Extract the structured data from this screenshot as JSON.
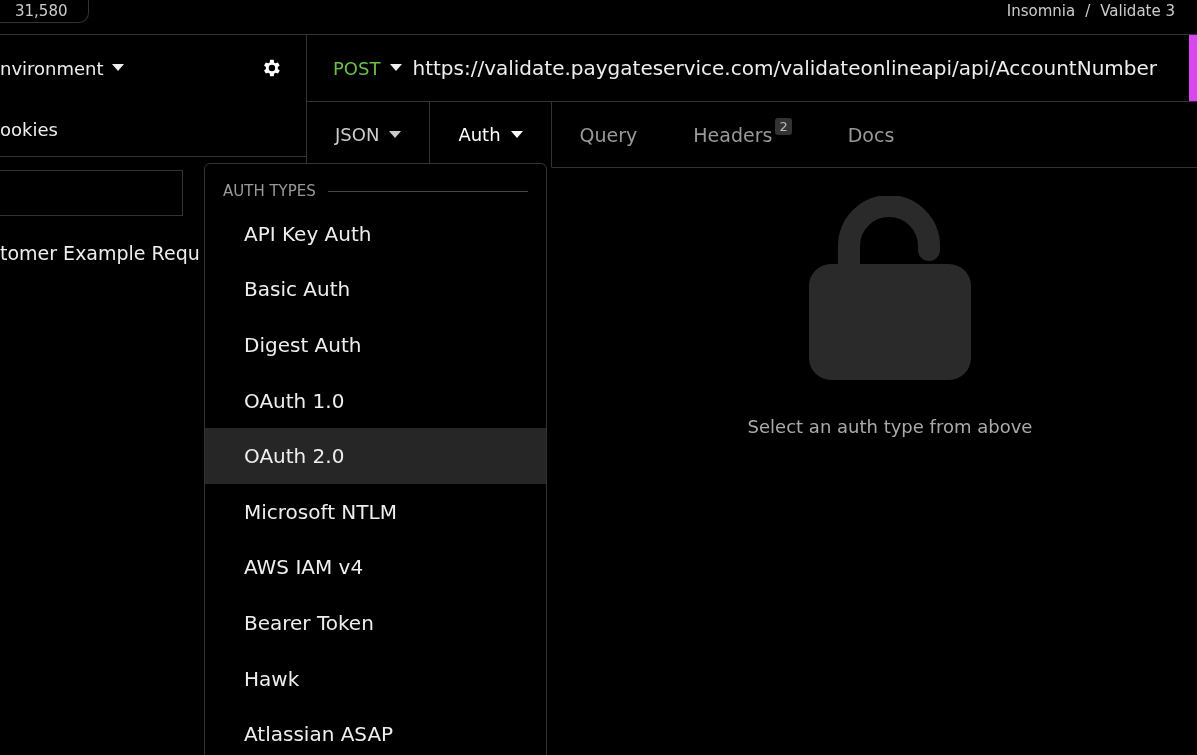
{
  "top_bar": {
    "count": "31,580",
    "breadcrumb": [
      {
        "label": "Insomnia"
      },
      {
        "label": "Validate 3"
      }
    ],
    "separator": "/"
  },
  "sidebar": {
    "environment": "nvironment",
    "cookies": "ookies",
    "requests": [
      {
        "label": "tomer Example Requ",
        "selected": false
      }
    ]
  },
  "request": {
    "method": "POST",
    "url": "https://validate.paygateservice.com/validateonlineapi/api/AccountNumber"
  },
  "tabs": [
    {
      "label": "JSON",
      "kind": "dropdown",
      "selected": false
    },
    {
      "label": "Auth",
      "kind": "dropdown",
      "selected": true
    },
    {
      "label": "Query",
      "kind": "tab",
      "selected": false
    },
    {
      "label": "Headers",
      "kind": "tab",
      "badge": "2",
      "selected": false
    },
    {
      "label": "Docs",
      "kind": "tab",
      "selected": false
    }
  ],
  "auth_menu": {
    "heading": "AUTH TYPES",
    "items": [
      {
        "label": "API Key Auth",
        "selected": false
      },
      {
        "label": "Basic Auth",
        "selected": false
      },
      {
        "label": "Digest Auth",
        "selected": false
      },
      {
        "label": "OAuth 1.0",
        "selected": false
      },
      {
        "label": "OAuth 2.0",
        "selected": true
      },
      {
        "label": "Microsoft NTLM",
        "selected": false
      },
      {
        "label": "AWS IAM v4",
        "selected": false
      },
      {
        "label": "Bearer Token",
        "selected": false
      },
      {
        "label": "Hawk",
        "selected": false
      },
      {
        "label": "Atlassian ASAP",
        "selected": false
      }
    ]
  },
  "empty_state": {
    "message": "Select an auth type from above"
  }
}
